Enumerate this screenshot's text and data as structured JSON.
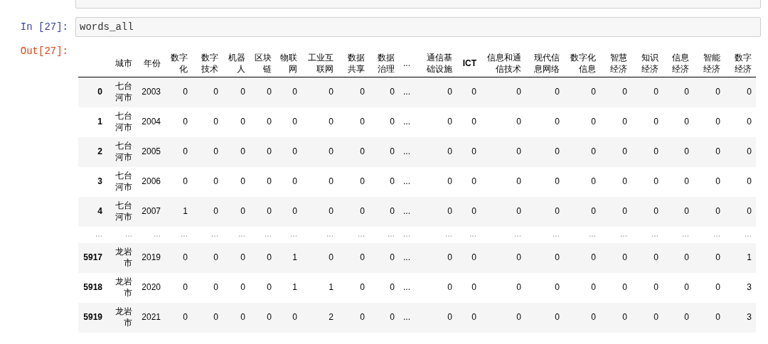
{
  "cells": [
    {
      "kind": "clipped"
    },
    {
      "kind": "code",
      "prompt": "In [27]:",
      "code": [
        {
          "kind": "name",
          "text": "words_all"
        }
      ]
    }
  ],
  "output": {
    "prompt": "Out[27]:",
    "table": {
      "columns": [
        "城市",
        "年份",
        "数字化",
        "数字技术",
        "机器人",
        "区块链",
        "物联网",
        "工业互联网",
        "数据共享",
        "数据治理",
        "...",
        "通信基础设施",
        "ICT",
        "信息和通信技术",
        "现代信息网络",
        "数字化信息",
        "智慧经济",
        "知识经济",
        "信息经济",
        "智能经济",
        "数字经济"
      ],
      "rows": [
        {
          "kind": "data",
          "index": "0",
          "cells": [
            "七台河市",
            "2003",
            "0",
            "0",
            "0",
            "0",
            "0",
            "0",
            "0",
            "0",
            "...",
            "0",
            "0",
            "0",
            "0",
            "0",
            "0",
            "0",
            "0",
            "0",
            "0"
          ]
        },
        {
          "kind": "data",
          "index": "1",
          "cells": [
            "七台河市",
            "2004",
            "0",
            "0",
            "0",
            "0",
            "0",
            "0",
            "0",
            "0",
            "...",
            "0",
            "0",
            "0",
            "0",
            "0",
            "0",
            "0",
            "0",
            "0",
            "0"
          ]
        },
        {
          "kind": "data",
          "index": "2",
          "cells": [
            "七台河市",
            "2005",
            "0",
            "0",
            "0",
            "0",
            "0",
            "0",
            "0",
            "0",
            "...",
            "0",
            "0",
            "0",
            "0",
            "0",
            "0",
            "0",
            "0",
            "0",
            "0"
          ]
        },
        {
          "kind": "data",
          "index": "3",
          "cells": [
            "七台河市",
            "2006",
            "0",
            "0",
            "0",
            "0",
            "0",
            "0",
            "0",
            "0",
            "...",
            "0",
            "0",
            "0",
            "0",
            "0",
            "0",
            "0",
            "0",
            "0",
            "0"
          ]
        },
        {
          "kind": "data",
          "index": "4",
          "cells": [
            "七台河市",
            "2007",
            "1",
            "0",
            "0",
            "0",
            "0",
            "0",
            "0",
            "0",
            "...",
            "0",
            "0",
            "0",
            "0",
            "0",
            "0",
            "0",
            "0",
            "0",
            "0"
          ]
        },
        {
          "kind": "ellipsis",
          "index": "...",
          "cells": [
            "...",
            "...",
            "...",
            "...",
            "...",
            "...",
            "...",
            "...",
            "...",
            "...",
            "...",
            "...",
            "...",
            "...",
            "...",
            "...",
            "...",
            "...",
            "...",
            "...",
            "..."
          ]
        },
        {
          "kind": "data",
          "index": "5917",
          "cells": [
            "龙岩市",
            "2019",
            "0",
            "0",
            "0",
            "0",
            "1",
            "0",
            "0",
            "0",
            "...",
            "0",
            "0",
            "0",
            "0",
            "0",
            "0",
            "0",
            "0",
            "0",
            "1"
          ]
        },
        {
          "kind": "data",
          "index": "5918",
          "cells": [
            "龙岩市",
            "2020",
            "0",
            "0",
            "0",
            "0",
            "1",
            "1",
            "0",
            "0",
            "...",
            "0",
            "0",
            "0",
            "0",
            "0",
            "0",
            "0",
            "0",
            "0",
            "3"
          ]
        },
        {
          "kind": "data",
          "index": "5919",
          "cells": [
            "龙岩市",
            "2021",
            "0",
            "0",
            "0",
            "0",
            "0",
            "2",
            "0",
            "0",
            "...",
            "0",
            "0",
            "0",
            "0",
            "0",
            "0",
            "0",
            "0",
            "0",
            "3"
          ]
        }
      ]
    }
  }
}
